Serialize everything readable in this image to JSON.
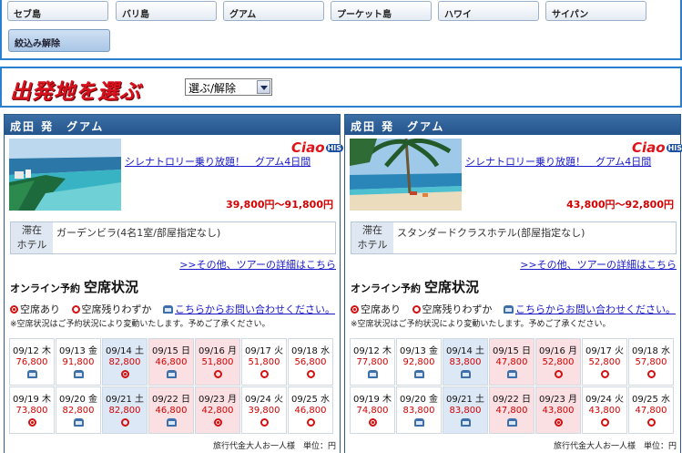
{
  "destinations": [
    "セブ島",
    "バリ島",
    "グアム",
    "プーケット島",
    "ハワイ",
    "サイパン"
  ],
  "reset_label": "絞込み解除",
  "origin": {
    "title": "出発地を選ぶ",
    "select_value": "選ぶ/解除"
  },
  "legend": {
    "available": "空席あり",
    "few": "空席残りわずか",
    "contact": "こちらからお問い合わせください。"
  },
  "tours": [
    {
      "header": "成田 発　グアム",
      "logo": "Ciao",
      "logo_badge": "HIS",
      "title": "シレナトロリー乗り放題！　グアム4日間",
      "price": "39,800円〜91,800円",
      "hotel_label": "滞在ホテル",
      "hotel": "ガーデンビラ(4名1室/部屋指定なし)",
      "more": ">>その他、ツアーの詳細はこちら",
      "avail_prefix": "オンライン予約",
      "avail_title": "空席状況",
      "note": "※空席状況はご予約状況により変動いたします。予めご了承ください。",
      "footnote": "旅行代金大人お一人様　単位：円",
      "days": [
        {
          "date": "09/12",
          "dow": "木",
          "price": "76,800",
          "status": "contact",
          "type": "normal"
        },
        {
          "date": "09/13",
          "dow": "金",
          "price": "91,800",
          "status": "contact",
          "type": "normal"
        },
        {
          "date": "09/14",
          "dow": "土",
          "price": "82,800",
          "status": "available",
          "type": "sat"
        },
        {
          "date": "09/15",
          "dow": "日",
          "price": "46,800",
          "status": "contact",
          "type": "hol"
        },
        {
          "date": "09/16",
          "dow": "月",
          "price": "51,800",
          "status": "few",
          "type": "hol"
        },
        {
          "date": "09/17",
          "dow": "火",
          "price": "51,800",
          "status": "few",
          "type": "normal"
        },
        {
          "date": "09/18",
          "dow": "水",
          "price": "56,800",
          "status": "few",
          "type": "normal"
        },
        {
          "date": "09/19",
          "dow": "木",
          "price": "73,800",
          "status": "available",
          "type": "normal"
        },
        {
          "date": "09/20",
          "dow": "金",
          "price": "82,800",
          "status": "contact",
          "type": "normal"
        },
        {
          "date": "09/21",
          "dow": "土",
          "price": "82,800",
          "status": "few",
          "type": "sat"
        },
        {
          "date": "09/22",
          "dow": "日",
          "price": "46,800",
          "status": "contact",
          "type": "hol"
        },
        {
          "date": "09/23",
          "dow": "月",
          "price": "42,800",
          "status": "available",
          "type": "hol"
        },
        {
          "date": "09/24",
          "dow": "火",
          "price": "39,800",
          "status": "few",
          "type": "normal"
        },
        {
          "date": "09/25",
          "dow": "水",
          "price": "46,800",
          "status": "few",
          "type": "normal"
        }
      ]
    },
    {
      "header": "成田 発　グアム",
      "logo": "Ciao",
      "logo_badge": "HIS",
      "title": "シレナトロリー乗り放題！　グアム4日間",
      "price": "43,800円〜92,800円",
      "hotel_label": "滞在ホテル",
      "hotel": "スタンダードクラスホテル(部屋指定なし)",
      "more": ">>その他、ツアーの詳細はこちら",
      "avail_prefix": "オンライン予約",
      "avail_title": "空席状況",
      "note": "※空席状況はご予約状況により変動いたします。予めご了承ください。",
      "footnote": "旅行代金大人お一人様　単位：円",
      "days": [
        {
          "date": "09/12",
          "dow": "木",
          "price": "77,800",
          "status": "contact",
          "type": "normal"
        },
        {
          "date": "09/13",
          "dow": "金",
          "price": "92,800",
          "status": "contact",
          "type": "normal"
        },
        {
          "date": "09/14",
          "dow": "土",
          "price": "83,800",
          "status": "contact",
          "type": "sat"
        },
        {
          "date": "09/15",
          "dow": "日",
          "price": "47,800",
          "status": "contact",
          "type": "hol"
        },
        {
          "date": "09/16",
          "dow": "月",
          "price": "52,800",
          "status": "few",
          "type": "hol"
        },
        {
          "date": "09/17",
          "dow": "火",
          "price": "52,800",
          "status": "few",
          "type": "normal"
        },
        {
          "date": "09/18",
          "dow": "水",
          "price": "57,800",
          "status": "few",
          "type": "normal"
        },
        {
          "date": "09/19",
          "dow": "木",
          "price": "74,800",
          "status": "available",
          "type": "normal"
        },
        {
          "date": "09/20",
          "dow": "金",
          "price": "83,800",
          "status": "contact",
          "type": "normal"
        },
        {
          "date": "09/21",
          "dow": "土",
          "price": "83,800",
          "status": "contact",
          "type": "sat"
        },
        {
          "date": "09/22",
          "dow": "日",
          "price": "47,800",
          "status": "contact",
          "type": "hol"
        },
        {
          "date": "09/23",
          "dow": "月",
          "price": "43,800",
          "status": "available",
          "type": "hol"
        },
        {
          "date": "09/24",
          "dow": "火",
          "price": "43,800",
          "status": "few",
          "type": "normal"
        },
        {
          "date": "09/25",
          "dow": "水",
          "price": "47,800",
          "status": "few",
          "type": "normal"
        }
      ]
    }
  ]
}
